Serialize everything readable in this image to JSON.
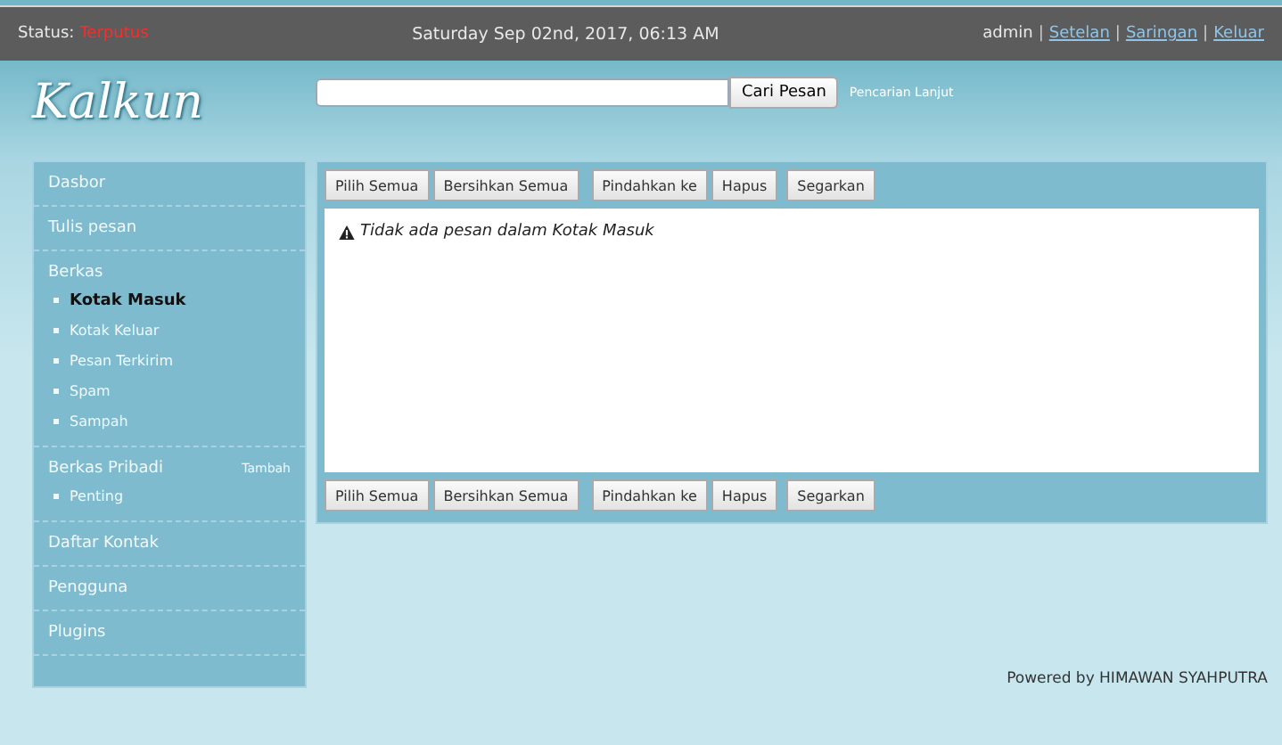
{
  "status_bar": {
    "label": "Status:",
    "value": "Terputus",
    "datetime": "Saturday Sep 02nd, 2017, 06:13 AM",
    "user": "admin",
    "separator": "|",
    "links": [
      "Setelan",
      "Saringan",
      "Keluar"
    ]
  },
  "logo": "Kalkun",
  "search": {
    "button": "Cari Pesan",
    "advanced_link": "Pencarian Lanjut"
  },
  "sidebar": {
    "items": [
      {
        "label": "Dasbor"
      },
      {
        "label": "Tulis pesan"
      },
      {
        "label": "Berkas",
        "children": [
          {
            "label": "Kotak Masuk",
            "selected": true
          },
          {
            "label": "Kotak Keluar",
            "selected": false
          },
          {
            "label": "Pesan Terkirim",
            "selected": false
          },
          {
            "label": "Spam",
            "selected": false
          },
          {
            "label": "Sampah",
            "selected": false
          }
        ]
      },
      {
        "label": "Berkas Pribadi",
        "action": "Tambah",
        "children": [
          {
            "label": "Penting",
            "selected": false
          }
        ]
      },
      {
        "label": "Daftar Kontak"
      },
      {
        "label": "Pengguna"
      },
      {
        "label": "Plugins"
      }
    ]
  },
  "toolbar_top": [
    "Pilih Semua",
    "Bersihkan Semua",
    "Pindahkan ke",
    "Hapus",
    "Segarkan"
  ],
  "message": "Tidak ada pesan dalam Kotak Masuk",
  "toolbar_bottom": [
    "Pilih Semua",
    "Bersihkan Semua",
    "Pindahkan ke",
    "Hapus",
    "Segarkan"
  ],
  "footer": "Powered by HIMAWAN SYAHPUTRA"
}
